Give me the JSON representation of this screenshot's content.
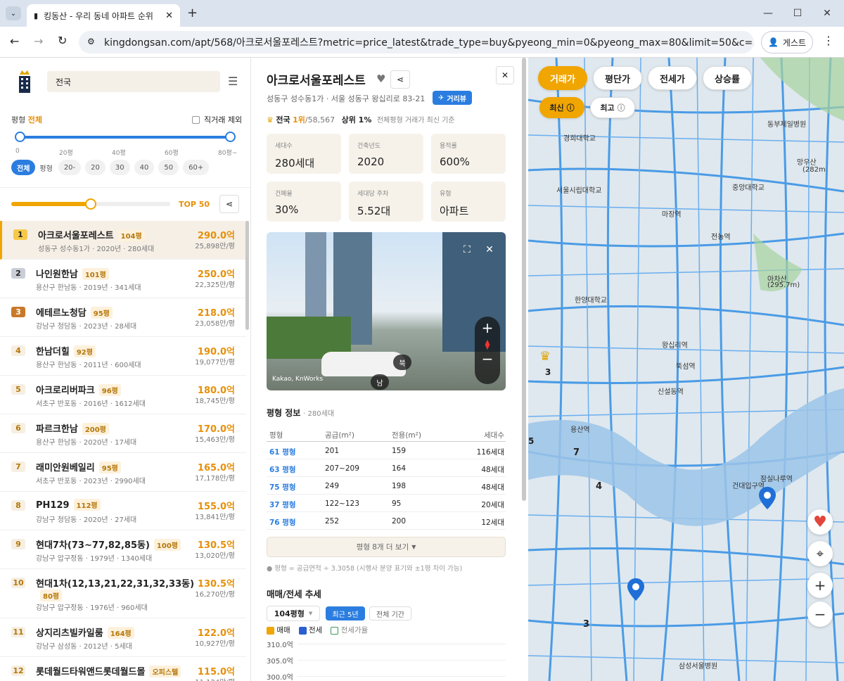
{
  "browser": {
    "tab_title": "킹동산 - 우리 동네 아파트 순위",
    "url": "kingdongsan.com/apt/568/아크로서울포레스트?metric=price_latest&trade_type=buy&pyeong_min=0&pyeong_max=80&limit=50&c=37.54463%2C12...",
    "guest_label": "게스트"
  },
  "sidebar": {
    "search_value": "전국",
    "pyeong_label": "평형",
    "pyeong_value": "전체",
    "direct_deal_exclude": "직거래 제외",
    "slider_ticks": [
      "0",
      "20평",
      "40평",
      "60평",
      "80평~"
    ],
    "filter_label_all": "전체",
    "filter_label_pyeong": "평형",
    "filter_chips": [
      "20-",
      "20",
      "30",
      "40",
      "50",
      "60+"
    ],
    "top_label": "TOP 50",
    "top_fraction": 0.5
  },
  "ranking": [
    {
      "rank": "1",
      "name": "아크로서울포레스트",
      "pyeong": "104평",
      "sub": "성동구 성수동1가 · 2020년 · 280세대",
      "price": "290.0억",
      "pp": "25,898만/평"
    },
    {
      "rank": "2",
      "name": "나인원한남",
      "pyeong": "101평",
      "sub": "용산구 한남동 · 2019년 · 341세대",
      "price": "250.0억",
      "pp": "22,325만/평"
    },
    {
      "rank": "3",
      "name": "에테르노청담",
      "pyeong": "95평",
      "sub": "강남구 청담동 · 2023년 · 28세대",
      "price": "218.0억",
      "pp": "23,058만/평"
    },
    {
      "rank": "4",
      "name": "한남더힐",
      "pyeong": "92평",
      "sub": "용산구 한남동 · 2011년 · 600세대",
      "price": "190.0억",
      "pp": "19,077만/평"
    },
    {
      "rank": "5",
      "name": "아크로리버파크",
      "pyeong": "96평",
      "sub": "서초구 반포동 · 2016년 · 1612세대",
      "price": "180.0억",
      "pp": "18,745만/평"
    },
    {
      "rank": "6",
      "name": "파르크한남",
      "pyeong": "200평",
      "sub": "용산구 한남동 · 2020년 · 17세대",
      "price": "170.0억",
      "pp": "15,463만/평"
    },
    {
      "rank": "7",
      "name": "래미안원베일리",
      "pyeong": "95평",
      "sub": "서초구 반포동 · 2023년 · 2990세대",
      "price": "165.0억",
      "pp": "17,178만/평"
    },
    {
      "rank": "8",
      "name": "PH129",
      "pyeong": "112평",
      "sub": "강남구 청담동 · 2020년 · 27세대",
      "price": "155.0억",
      "pp": "13,841만/평"
    },
    {
      "rank": "9",
      "name": "현대7차(73~77,82,85동)",
      "pyeong": "100평",
      "sub": "강남구 압구정동 · 1979년 · 1340세대",
      "price": "130.5억",
      "pp": "13,020만/평"
    },
    {
      "rank": "10",
      "name": "현대1차(12,13,21,22,31,32,33동)",
      "pyeong": "80평",
      "sub": "강남구 압구정동 · 1976년 · 960세대",
      "price": "130.5억",
      "pp": "16,270만/평"
    },
    {
      "rank": "11",
      "name": "상지리츠빌카일룸",
      "pyeong": "164평",
      "sub": "강남구 삼성동 · 2012년 · 5세대",
      "price": "122.0억",
      "pp": "10,927만/평"
    },
    {
      "rank": "12",
      "name": "롯데월드타워앤드롯데월드몰",
      "pyeong": "오피스텔",
      "sub": "",
      "price": "115.0억",
      "pp": "11,124만/평"
    }
  ],
  "detail": {
    "title": "아크로서울포레스트",
    "address": "성동구 성수동1가 · 서울 성동구 왕십리로 83-21",
    "roadview_label": "거리뷰",
    "rank_prefix": "전국",
    "rank_value": "1위",
    "rank_total": "/58,567",
    "rank_percent": "상위 1%",
    "rank_note": "전체평형 거래가 최신 기준",
    "stats": [
      {
        "label": "세대수",
        "value": "280세대"
      },
      {
        "label": "건축년도",
        "value": "2020"
      },
      {
        "label": "용적률",
        "value": "600%"
      },
      {
        "label": "건폐율",
        "value": "30%"
      },
      {
        "label": "세대당 주차",
        "value": "5.52대"
      },
      {
        "label": "유형",
        "value": "아파트"
      }
    ],
    "streetview_credit": "Kakao, KnWorks",
    "streetview_north": "북",
    "streetview_south": "남",
    "pyeong_info_title": "평형 정보",
    "pyeong_info_count": "· 280세대",
    "table_headers": [
      "평형",
      "공급(m²)",
      "전용(m²)",
      "세대수"
    ],
    "table_rows": [
      [
        "61 평형",
        "201",
        "159",
        "116세대"
      ],
      [
        "63 평형",
        "207~209",
        "164",
        "48세대"
      ],
      [
        "75 평형",
        "249",
        "198",
        "48세대"
      ],
      [
        "37 평형",
        "122~123",
        "95",
        "20세대"
      ],
      [
        "76 평형",
        "252",
        "200",
        "12세대"
      ]
    ],
    "more_label": "평형 8개 더 보기",
    "note": "● 평형 = 공급면적 ÷ 3.3058 (시행사 분양 표기와 ±1평 차이 가능)",
    "trend_title": "매매/전세 추세",
    "trend_select": "104평형",
    "trend_btn_recent": "최근 5년",
    "trend_btn_all": "전체 기간",
    "legend": [
      "매매",
      "전세",
      "전세가율"
    ],
    "y_ticks": [
      "310.0억",
      "305.0억",
      "300.0억"
    ]
  },
  "map": {
    "tabs": [
      "거래가",
      "평단가",
      "전세가",
      "상승률"
    ],
    "sort_latest": "최신",
    "sort_best": "최고",
    "labels": [
      "경희대학교",
      "서울시립대학교",
      "한양대학교",
      "아차산",
      "(295.7m)",
      "전농역",
      "신설동역",
      "용산역",
      "건대입구역",
      "삼성서울병원",
      "왕십리역",
      "뚝섬역",
      "잠실나루역",
      "마장역",
      "망우산",
      "(282m",
      "동부제일병원",
      "중앙대학교"
    ],
    "cluster_numbers": [
      "3",
      "7",
      "4",
      "3",
      "5"
    ]
  }
}
